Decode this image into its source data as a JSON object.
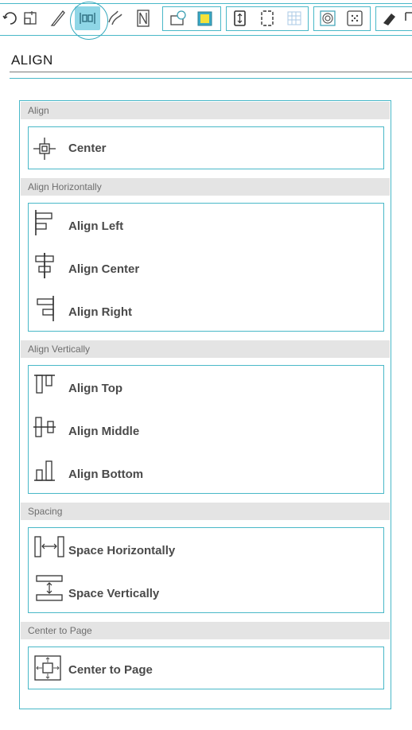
{
  "panel": {
    "title": "ALIGN"
  },
  "sections": {
    "align": {
      "header": "Align",
      "items": [
        "Center"
      ]
    },
    "horizontal": {
      "header": "Align Horizontally",
      "items": [
        "Align Left",
        "Align Center",
        "Align Right"
      ]
    },
    "vertical": {
      "header": "Align Vertically",
      "items": [
        "Align Top",
        "Align Middle",
        "Align Bottom"
      ]
    },
    "spacing": {
      "header": "Spacing",
      "items": [
        "Space Horizontally",
        "Space Vertically"
      ]
    },
    "page": {
      "header": "Center to Page",
      "items": [
        "Center to Page"
      ]
    }
  },
  "toolbar": {
    "active_tool": "align-icon",
    "icons": [
      "rotate-icon",
      "transform-icon",
      "knife-icon",
      "align-icon",
      "replicate-icon",
      "nest-icon",
      "print-and-cut-icon",
      "fill-color-icon",
      "page-portrait-icon",
      "page-border-icon",
      "grid-icon",
      "trace-icon",
      "dots-pattern-icon",
      "eraser-icon"
    ]
  },
  "colors": {
    "accent": "#49b8c8",
    "active_fill": "#8fd6e6",
    "section_bg": "#e4e4e4",
    "label": "#4a4a4a"
  }
}
